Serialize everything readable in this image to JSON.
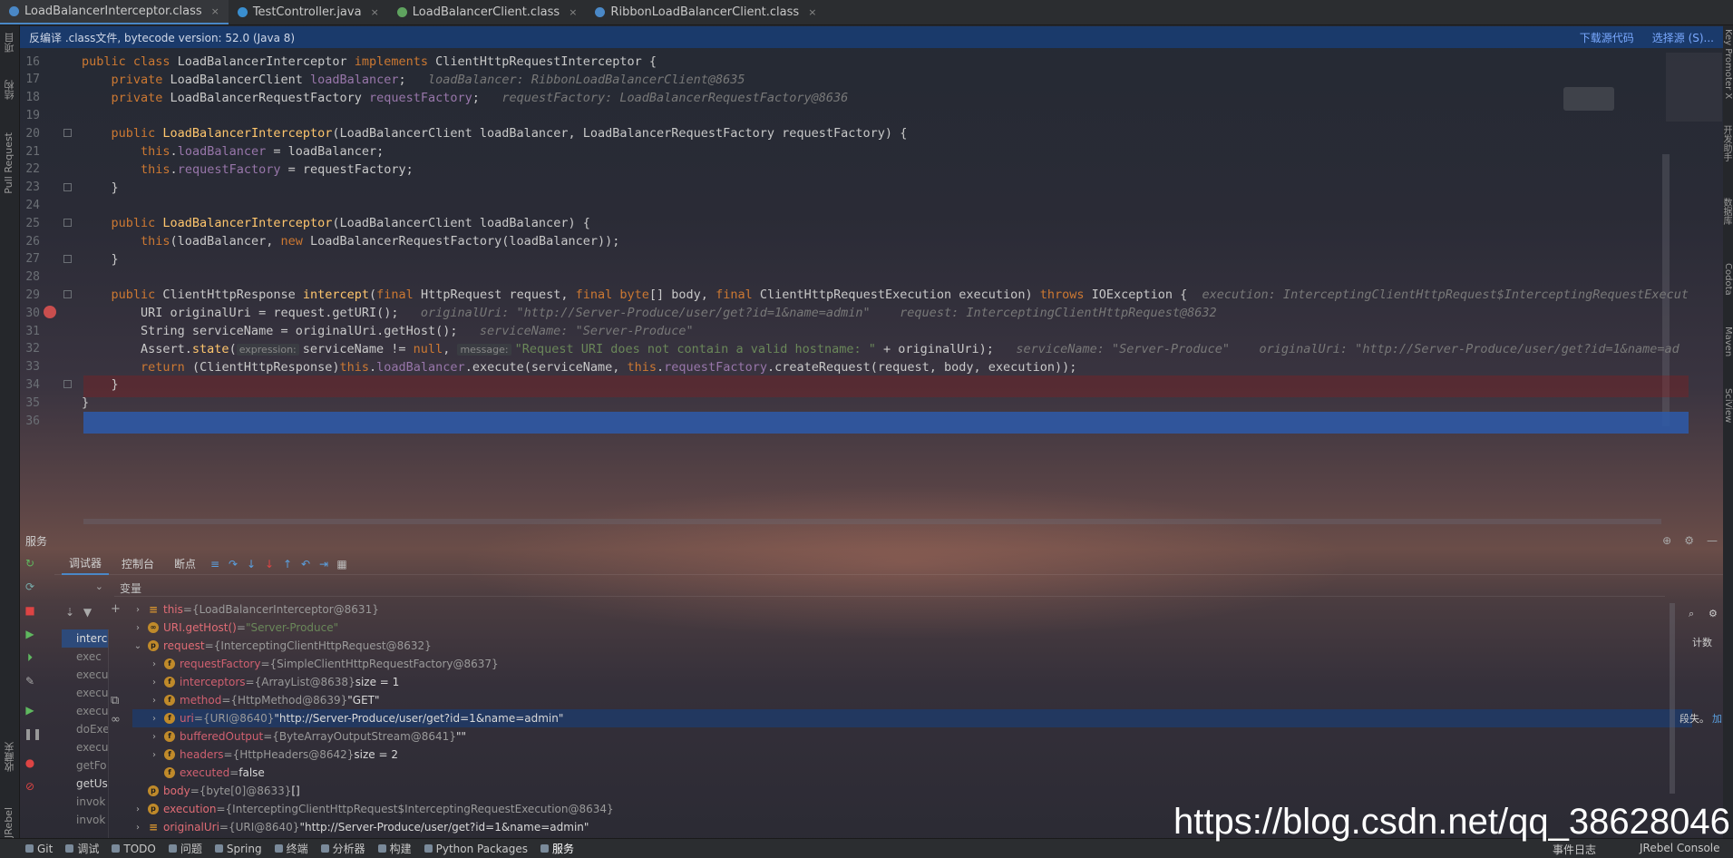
{
  "tabs": [
    {
      "label": "LoadBalancerInterceptor.class",
      "color": "#4a88c7",
      "active": true
    },
    {
      "label": "TestController.java",
      "color": "#3a8fd0",
      "active": false
    },
    {
      "label": "LoadBalancerClient.class",
      "color": "#5fa35f",
      "active": false
    },
    {
      "label": "RibbonLoadBalancerClient.class",
      "color": "#4a88c7",
      "active": false
    }
  ],
  "tab_close": "×",
  "notice": {
    "text": "反编译 .class文件, bytecode version: 52.0 (Java 8)",
    "download": "下载源代码",
    "choose": "选择源 (S)..."
  },
  "left_labels": {
    "project": "项目",
    "structure": "结构",
    "pull_request": "Pull Request",
    "favorites": "收藏夹",
    "jrebel": "JRebel"
  },
  "right_labels": {
    "key": "Key Promoter X",
    "notifications": "开发助手",
    "database": "数据库",
    "codota": "Codota",
    "maven": "Maven",
    "sciview": "SciView"
  },
  "code_lines": [
    {
      "n": "16",
      "segs": [
        [
          "kw",
          "public class "
        ],
        [
          "",
          "LoadBalancerInterceptor "
        ],
        [
          "kw",
          "implements "
        ],
        [
          "",
          "ClientHttpRequestInterceptor {"
        ]
      ]
    },
    {
      "n": "17",
      "segs": [
        [
          "",
          "    "
        ],
        [
          "kw",
          "private "
        ],
        [
          "",
          "LoadBalancerClient "
        ],
        [
          "fld",
          "loadBalancer"
        ],
        [
          "",
          ";   "
        ],
        [
          "hint",
          "loadBalancer: RibbonLoadBalancerClient@8635"
        ]
      ]
    },
    {
      "n": "18",
      "segs": [
        [
          "",
          "    "
        ],
        [
          "kw",
          "private "
        ],
        [
          "",
          "LoadBalancerRequestFactory "
        ],
        [
          "fld",
          "requestFactory"
        ],
        [
          "",
          ";   "
        ],
        [
          "hint",
          "requestFactory: LoadBalancerRequestFactory@8636"
        ]
      ]
    },
    {
      "n": "19",
      "segs": []
    },
    {
      "n": "20",
      "segs": [
        [
          "",
          "    "
        ],
        [
          "kw",
          "public "
        ],
        [
          "fn",
          "LoadBalancerInterceptor"
        ],
        [
          "",
          "(LoadBalancerClient loadBalancer, LoadBalancerRequestFactory requestFactory) {"
        ]
      ]
    },
    {
      "n": "21",
      "segs": [
        [
          "",
          "        "
        ],
        [
          "kw",
          "this"
        ],
        [
          "",
          "."
        ],
        [
          "fld",
          "loadBalancer"
        ],
        [
          "",
          " = loadBalancer;"
        ]
      ]
    },
    {
      "n": "22",
      "segs": [
        [
          "",
          "        "
        ],
        [
          "kw",
          "this"
        ],
        [
          "",
          "."
        ],
        [
          "fld",
          "requestFactory"
        ],
        [
          "",
          " = requestFactory;"
        ]
      ]
    },
    {
      "n": "23",
      "segs": [
        [
          "",
          "    }"
        ]
      ]
    },
    {
      "n": "24",
      "segs": []
    },
    {
      "n": "25",
      "segs": [
        [
          "",
          "    "
        ],
        [
          "kw",
          "public "
        ],
        [
          "fn",
          "LoadBalancerInterceptor"
        ],
        [
          "",
          "(LoadBalancerClient loadBalancer) {"
        ]
      ]
    },
    {
      "n": "26",
      "segs": [
        [
          "",
          "        "
        ],
        [
          "kw",
          "this"
        ],
        [
          "",
          "(loadBalancer, "
        ],
        [
          "kw",
          "new "
        ],
        [
          "",
          "LoadBalancerRequestFactory(loadBalancer));"
        ]
      ]
    },
    {
      "n": "27",
      "segs": [
        [
          "",
          "    }"
        ]
      ]
    },
    {
      "n": "28",
      "segs": []
    },
    {
      "n": "29",
      "segs": [
        [
          "",
          "    "
        ],
        [
          "kw",
          "public "
        ],
        [
          "",
          "ClientHttpResponse "
        ],
        [
          "fn",
          "intercept"
        ],
        [
          "",
          "("
        ],
        [
          "kw",
          "final "
        ],
        [
          "",
          "HttpRequest request, "
        ],
        [
          "kw",
          "final byte"
        ],
        [
          "",
          "[] body, "
        ],
        [
          "kw",
          "final "
        ],
        [
          "",
          "ClientHttpRequestExecution execution) "
        ],
        [
          "kw",
          "throws "
        ],
        [
          "",
          "IOException {  "
        ],
        [
          "hint",
          "execution: InterceptingClientHttpRequest$InterceptingRequestExecut"
        ]
      ]
    },
    {
      "n": "30",
      "segs": [
        [
          "",
          "        URI originalUri = request.getURI();   "
        ],
        [
          "hint",
          "originalUri: \"http://Server-Produce/user/get?id=1&name=admin\"    request: InterceptingClientHttpRequest@8632"
        ]
      ]
    },
    {
      "n": "31",
      "segs": [
        [
          "",
          "        String serviceName = originalUri.getHost();   "
        ],
        [
          "hint",
          "serviceName: \"Server-Produce\""
        ]
      ]
    },
    {
      "n": "32",
      "segs": [
        [
          "",
          "        Assert."
        ],
        [
          "fn",
          "state"
        ],
        [
          "",
          "("
        ],
        [
          "tag",
          "expression:"
        ],
        [
          "",
          "serviceName != "
        ],
        [
          "kw",
          "null"
        ],
        [
          "",
          ", "
        ],
        [
          "tag",
          "message:"
        ],
        [
          "str",
          "\"Request URI does not contain a valid hostname: \""
        ],
        [
          "",
          " + originalUri);   "
        ],
        [
          "hint",
          "serviceName: \"Server-Produce\"    originalUri: \"http://Server-Produce/user/get?id=1&name=ad"
        ]
      ]
    },
    {
      "n": "33",
      "segs": [
        [
          "",
          "        "
        ],
        [
          "kw",
          "return "
        ],
        [
          "",
          "(ClientHttpResponse)"
        ],
        [
          "kw",
          "this"
        ],
        [
          "",
          "."
        ],
        [
          "fld",
          "loadBalancer"
        ],
        [
          "",
          ".execute(serviceName, "
        ],
        [
          "kw",
          "this"
        ],
        [
          "",
          "."
        ],
        [
          "fld",
          "requestFactory"
        ],
        [
          "",
          ".createRequest(request, body, execution));"
        ]
      ]
    },
    {
      "n": "34",
      "segs": [
        [
          "",
          "    }"
        ]
      ]
    },
    {
      "n": "35",
      "segs": [
        [
          "",
          "}"
        ]
      ]
    },
    {
      "n": "36",
      "segs": []
    }
  ],
  "services_title": "服务",
  "debug_tabs": {
    "debugger": "调试器",
    "console": "控制台",
    "breakpoints": "断点"
  },
  "variables_header": "变量",
  "frames": [
    "interc",
    "exec",
    "execu",
    "execu",
    "execu",
    "doExe",
    "execu",
    "getFo",
    "getUs",
    "invok",
    "invok"
  ],
  "variables": [
    {
      "indent": 0,
      "arrow": "›",
      "icon": "eq",
      "name": "this",
      "value": "{LoadBalancerInterceptor@8631}",
      "extra": ""
    },
    {
      "indent": 0,
      "arrow": "›",
      "icon": "oo",
      "name": "URI.getHost()",
      "value": "",
      "extra": "\"Server-Produce\""
    },
    {
      "indent": 0,
      "arrow": "⌄",
      "icon": "p",
      "name": "request",
      "value": "{InterceptingClientHttpRequest@8632}",
      "extra": ""
    },
    {
      "indent": 1,
      "arrow": "›",
      "icon": "f",
      "name": "requestFactory",
      "value": "{SimpleClientHttpRequestFactory@8637}",
      "extra": ""
    },
    {
      "indent": 1,
      "arrow": "›",
      "icon": "f",
      "name": "interceptors",
      "value": "{ArrayList@8638}",
      "extra": " size = 1"
    },
    {
      "indent": 1,
      "arrow": "›",
      "icon": "f",
      "name": "method",
      "value": "{HttpMethod@8639}",
      "extra": " \"GET\""
    },
    {
      "indent": 1,
      "arrow": "›",
      "icon": "f",
      "name": "uri",
      "value": "{URI@8640}",
      "extra": " \"http://Server-Produce/user/get?id=1&name=admin\"",
      "sel": true
    },
    {
      "indent": 1,
      "arrow": "›",
      "icon": "f",
      "name": "bufferedOutput",
      "value": "{ByteArrayOutputStream@8641}",
      "extra": " \"\""
    },
    {
      "indent": 1,
      "arrow": "›",
      "icon": "f",
      "name": "headers",
      "value": "{HttpHeaders@8642}",
      "extra": " size = 2"
    },
    {
      "indent": 1,
      "arrow": "",
      "icon": "f",
      "name": "executed",
      "value": "",
      "extra": "false"
    },
    {
      "indent": 0,
      "arrow": "",
      "icon": "p",
      "name": "body",
      "value": "{byte[0]@8633}",
      "extra": " []"
    },
    {
      "indent": 0,
      "arrow": "›",
      "icon": "p",
      "name": "execution",
      "value": "{InterceptingClientHttpRequest$InterceptingRequestExecution@8634}",
      "extra": ""
    },
    {
      "indent": 0,
      "arrow": "›",
      "icon": "eq",
      "name": "originalUri",
      "value": "{URI@8640}",
      "extra": " \"http://Server-Produce/user/get?id=1&name=admin\""
    }
  ],
  "right_panel": {
    "count": "计数",
    "truncated": "段失。",
    "add": "加"
  },
  "bottom_tools": [
    "Git",
    "调试",
    "TODO",
    "问题",
    "Spring",
    "终端",
    "分析器",
    "构建",
    "Python Packages",
    "服务"
  ],
  "bottom_right": {
    "events": "事件日志",
    "jrebel": "JRebel Console"
  },
  "watermark": "https://blog.csdn.net/qq_38628046"
}
